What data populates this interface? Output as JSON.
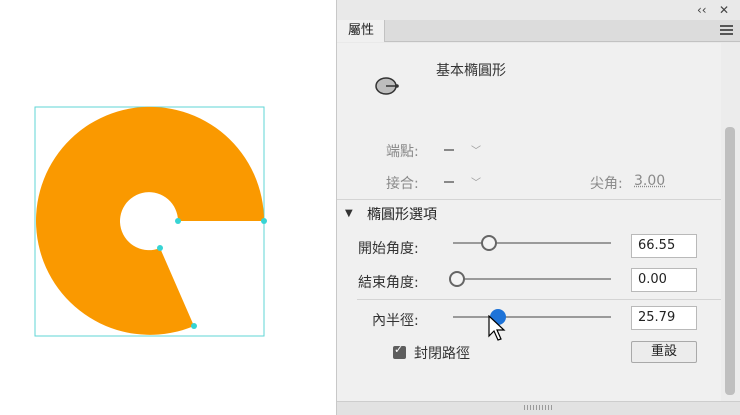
{
  "stage": {
    "shape_color": "#fa9900",
    "bbox_color": "#5fd6d6",
    "handle_color": "#37d4d4"
  },
  "panel": {
    "collapse_glyph": "‹‹",
    "close_glyph": "✕",
    "tab_label": "屬性",
    "tool_name": "基本橢圓形",
    "cap_label": "端點:",
    "join_label": "接合:",
    "miter_label": "尖角:",
    "miter_value": "3.00",
    "section_title": "橢圓形選項",
    "start_angle": {
      "label": "開始角度:",
      "value": "66.55",
      "slider_fraction": 0.2
    },
    "end_angle": {
      "label": "結束角度:",
      "value": "0.00",
      "slider_fraction": 0.0
    },
    "inner_radius": {
      "label": "內半徑:",
      "value": "25.79",
      "slider_fraction": 0.26
    },
    "close_path": {
      "label": "封閉路徑",
      "checked": true
    },
    "reset_label": "重設",
    "accent_color": "#1e73d8"
  }
}
